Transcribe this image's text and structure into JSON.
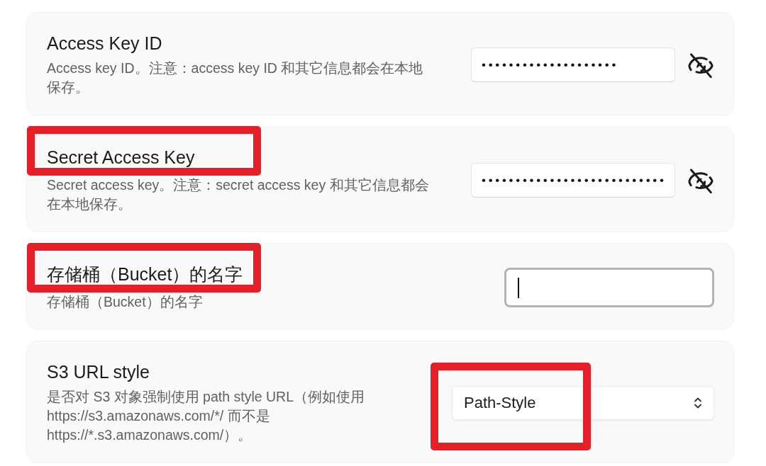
{
  "settings": [
    {
      "title": "Access Key ID",
      "description": "Access key ID。注意：access key ID 和其它信息都会在本地保存。",
      "title_highlighted": false,
      "control": {
        "kind": "password",
        "value": "••••••••••••••••••••",
        "revealed": false,
        "focused": false,
        "highlighted": false
      }
    },
    {
      "title": "Secret Access Key",
      "description": "Secret access key。注意：secret access key 和其它信息都会在本地保存。",
      "title_highlighted": true,
      "control": {
        "kind": "password",
        "value": "•••••••••••••••••••••••••••",
        "revealed": false,
        "focused": false,
        "highlighted": false
      }
    },
    {
      "title": "存储桶（Bucket）的名字",
      "description": "存储桶（Bucket）的名字",
      "title_highlighted": true,
      "control": {
        "kind": "text",
        "focused": true,
        "highlighted": false
      }
    },
    {
      "title": "S3 URL style",
      "description": "是否对 S3 对象强制使用 path style URL（例如使用 https://s3.amazonaws.com/*/ 而不是 https://*.s3.amazonaws.com/）。",
      "title_highlighted": false,
      "control": {
        "kind": "select",
        "value": "Path-Style",
        "highlighted": true
      }
    }
  ]
}
